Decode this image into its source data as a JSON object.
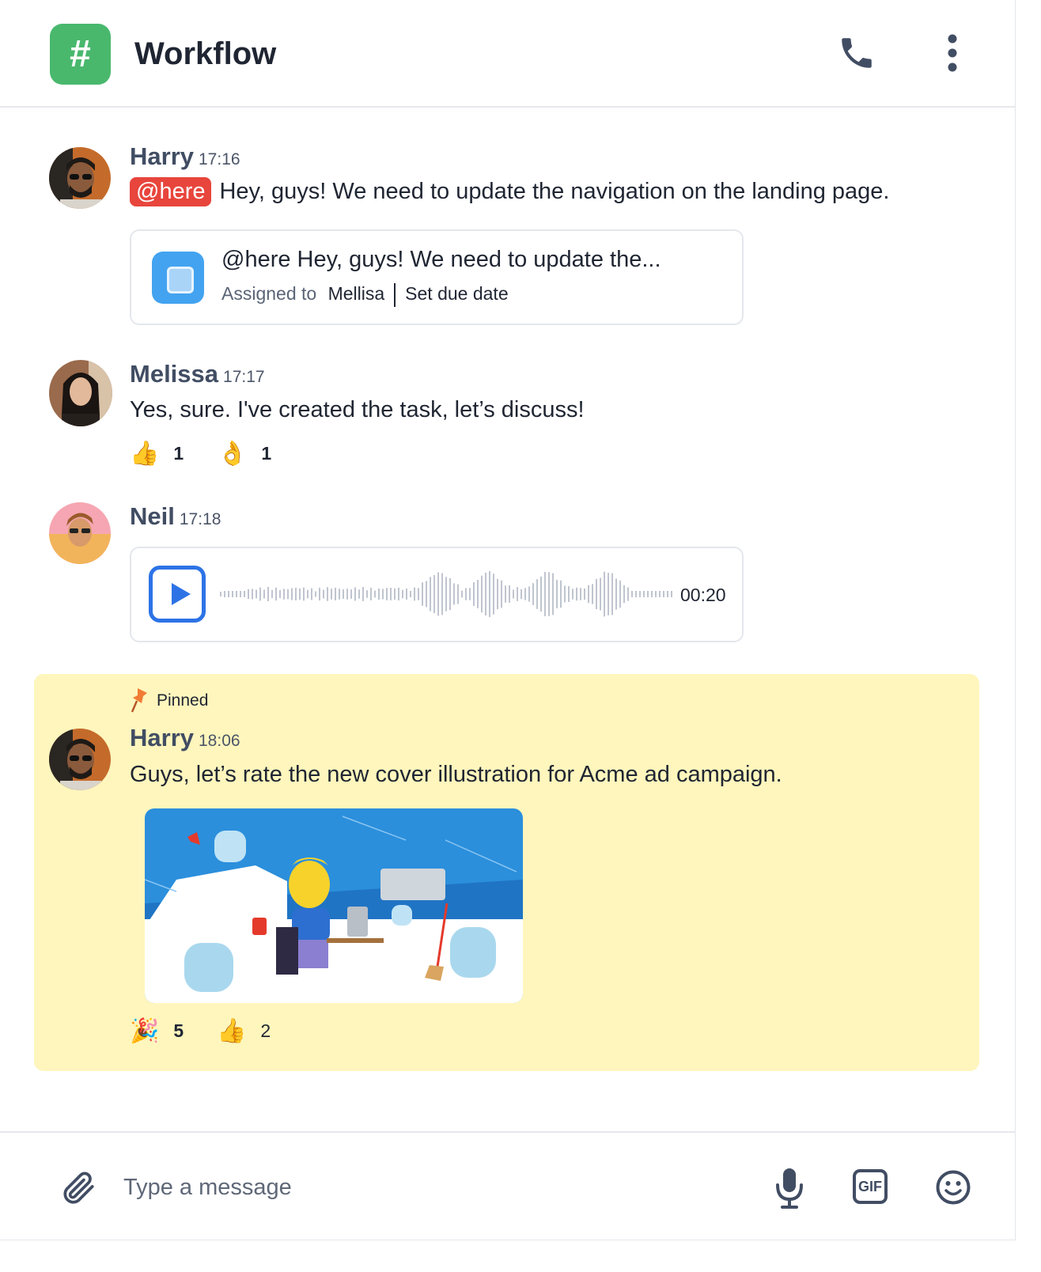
{
  "header": {
    "channel_icon_glyph": "#",
    "channel_icon_color": "#49b86d",
    "title": "Workflow",
    "phone_icon": "phone-icon",
    "more_icon": "more-vertical-icon"
  },
  "messages": [
    {
      "author": "Harry",
      "time": "17:16",
      "mention": "@here",
      "text": "Hey, guys! We need to update the navigation on the landing page.",
      "task": {
        "icon": "task-icon",
        "title": "@here Hey, guys! We need to update the...",
        "assigned_label": "Assigned to",
        "assignee": "Mellisa",
        "due_label": "Set due date"
      }
    },
    {
      "author": "Melissa",
      "time": "17:17",
      "text": "Yes, sure. I've created the task, let’s discuss!",
      "reactions": [
        {
          "emoji": "👍",
          "count": "1"
        },
        {
          "emoji": "👌",
          "count": "1"
        }
      ]
    },
    {
      "author": "Neil",
      "time": "17:18",
      "voice": {
        "duration": "00:20",
        "play_icon": "play-icon"
      }
    },
    {
      "pinned_label": "Pinned",
      "author": "Harry",
      "time": "18:06",
      "text": "Guys, let’s rate the new cover illustration for Acme ad campaign.",
      "reactions": [
        {
          "emoji": "🎉",
          "count": "5"
        },
        {
          "emoji": "👍",
          "count": "2"
        }
      ]
    }
  ],
  "composer": {
    "placeholder": "Type a message",
    "attach_icon": "paperclip-icon",
    "mic_icon": "microphone-icon",
    "gif_label": "GIF",
    "emoji_icon": "smiley-icon"
  },
  "colors": {
    "mention_bg": "#e8453c",
    "pinned_bg": "#fef6bd",
    "accent_blue": "#2d73e6",
    "task_icon_bg": "#43a3f0"
  }
}
